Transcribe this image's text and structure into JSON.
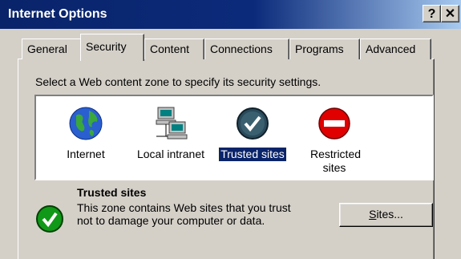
{
  "window": {
    "title": "Internet Options",
    "help_label": "?",
    "close_label": "✕"
  },
  "tabs": [
    {
      "label": "General",
      "active": false
    },
    {
      "label": "Security",
      "active": true
    },
    {
      "label": "Content",
      "active": false
    },
    {
      "label": "Connections",
      "active": false
    },
    {
      "label": "Programs",
      "active": false
    },
    {
      "label": "Advanced",
      "active": false
    }
  ],
  "security": {
    "instruction": "Select a Web content zone to specify its security settings.",
    "zones": [
      {
        "label": "Internet",
        "icon": "globe-icon",
        "selected": false
      },
      {
        "label": "Local intranet",
        "icon": "computers-network-icon",
        "selected": false
      },
      {
        "label": "Trusted sites",
        "icon": "checkmark-icon",
        "selected": true
      },
      {
        "label": "Restricted sites",
        "icon": "no-entry-icon",
        "selected": false
      }
    ],
    "selected_zone": {
      "title": "Trusted sites",
      "description": "This zone contains Web sites that you trust not to damage your computer or data.",
      "icon": "checkmark-circle-icon"
    },
    "sites_button": {
      "hotkey": "S",
      "label_rest": "ites..."
    }
  },
  "colors": {
    "titlebar": "#0a246a",
    "face": "#d4d0c8",
    "selection": "#0a246a",
    "trusted_green": "#109818",
    "restricted_red": "#e00000"
  }
}
